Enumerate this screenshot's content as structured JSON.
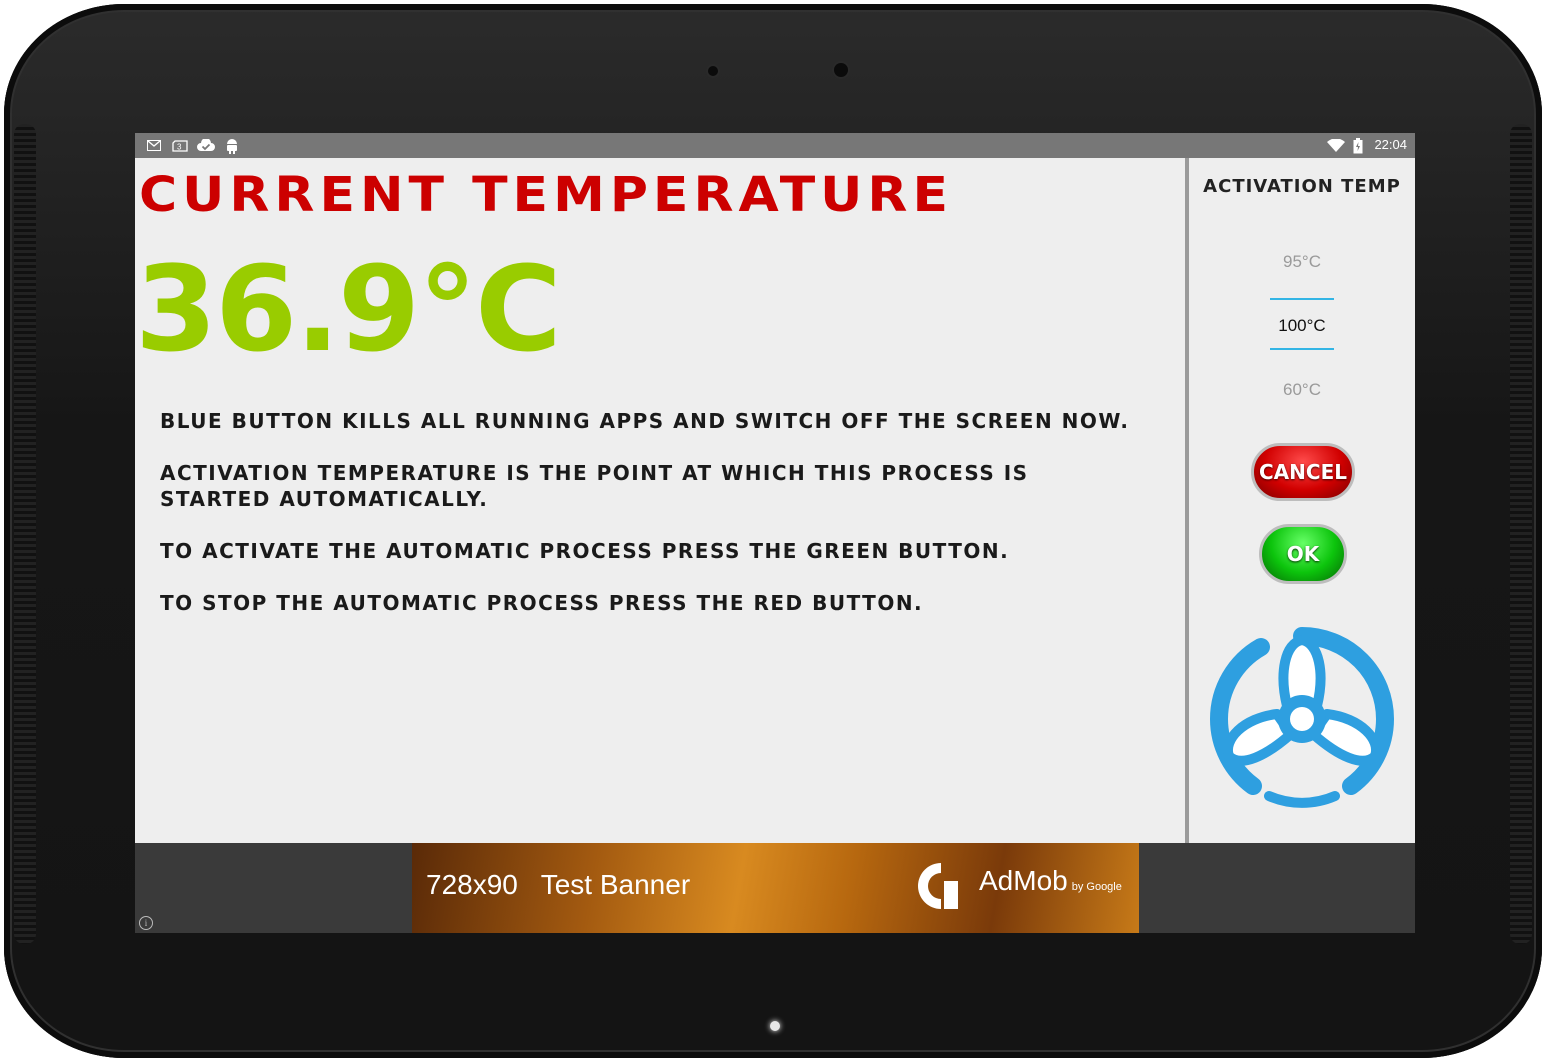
{
  "statusbar": {
    "time": "22:04",
    "left_icons": [
      "gmail-icon",
      "sd-card-icon",
      "check-cloud-icon",
      "android-debug-icon"
    ],
    "right_icons": [
      "wifi-icon",
      "battery-icon"
    ]
  },
  "main": {
    "title": "Current Temperature",
    "current_temp": "36.9°C",
    "info": [
      "Blue button kills all running apps and switch off the screen now.",
      "Activation temperature is the point at which this process is started automatically.",
      "To activate the automatic process press the green button.",
      "To stop the automatic process press the red button."
    ],
    "colors": {
      "title": "#cc0000",
      "temp": "#99cc00"
    }
  },
  "sidebar": {
    "title": "Activation Temp",
    "picker": {
      "above": "95°C",
      "selected": "100°C",
      "below": "60°C"
    },
    "cancel_label": "Cancel",
    "ok_label": "OK",
    "fan_button_icon": "fan-icon",
    "colors": {
      "cancel": "#d10000",
      "ok": "#0cc40c",
      "fan": "#2e9fe0",
      "picker_line": "#33b5e5"
    }
  },
  "ad": {
    "size_text": "728x90",
    "label": "Test Banner",
    "brand": "AdMob",
    "by": "by Google",
    "info_icon": "i"
  }
}
